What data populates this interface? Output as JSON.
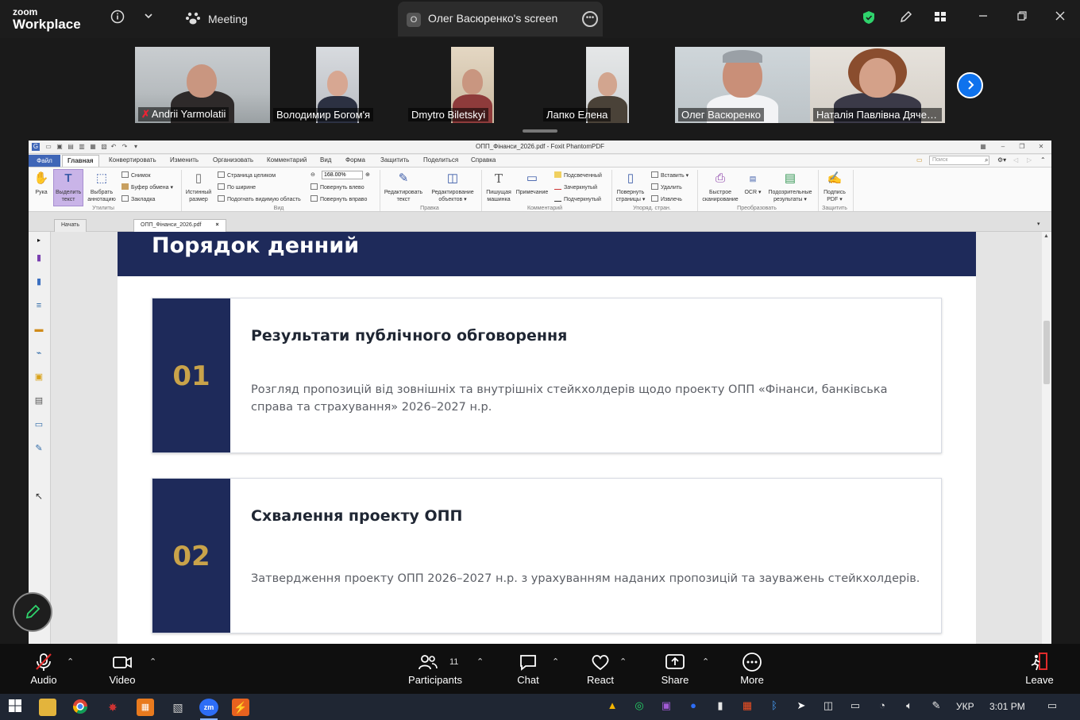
{
  "zoom": {
    "brand_line1": "zoom",
    "brand_line2": "Workplace",
    "meeting_tab": "Meeting",
    "screen_tab_badge": "O",
    "screen_tab": "Олег Васюренко's screen",
    "icons": [
      "info-icon",
      "chevron-down-icon",
      "meeting-paw-icon",
      "more-icon",
      "shield-icon",
      "pencil-icon",
      "grid-icon",
      "minimize-icon",
      "restore-icon",
      "close-icon"
    ]
  },
  "participants": [
    {
      "name": "Andrii Yarmolatii",
      "muted": true,
      "active": false
    },
    {
      "name": "Володимир Богом'я",
      "muted": false,
      "active": false
    },
    {
      "name": "Dmytro Biletskyi",
      "muted": false,
      "active": false
    },
    {
      "name": "Лапко Елена",
      "muted": false,
      "active": false
    },
    {
      "name": "Олег Васюренко",
      "muted": false,
      "active": true
    },
    {
      "name": "Наталія Павлівна Дячен...",
      "muted": false,
      "active": false
    }
  ],
  "app": {
    "title": "ОПП_Фінанси_2026.pdf - Foxit PhantomPDF",
    "menu_tabs": {
      "file": "Файл",
      "home": "Главная",
      "convert": "Конвертировать",
      "edit": "Изменить",
      "organize": "Организовать",
      "comment": "Комментарий",
      "view": "Вид",
      "form": "Форма",
      "protect": "Защитить",
      "share": "Поделиться",
      "help": "Справка"
    },
    "search_placeholder": "Поиск",
    "ribbon": {
      "hand": "Рука",
      "select_text": "Выделить текст",
      "select_annotation": "Выбрать аннотацию",
      "snapshot": "Снимок",
      "clipboard": "Буфер обмена ▾",
      "bookmark": "Закладка",
      "group_utilities": "Утилиты",
      "actual_size": "Истинный размер",
      "fit_page": "Страница целиком",
      "fit_width": "По ширине",
      "fit_visible": "Подогнать видимую область",
      "zoom_value": "168.00%",
      "rotate_left": "Повернуть влево",
      "rotate_right": "Повернуть вправо",
      "group_view": "Вид",
      "edit_text": "Редактировать текст",
      "edit_objects": "Редактирование объектов ▾",
      "group_edit": "Правка",
      "typewriter": "Пишущая машинка",
      "note": "Примечание",
      "highlight": "Подсвеченный",
      "strikeout": "Зачеркнутый",
      "underline": "Подчеркнутый",
      "group_comment": "Комментарий",
      "rotate_pages": "Повернуть страницы ▾",
      "insert": "Вставить ▾",
      "delete": "Удалить",
      "extract": "Извлечь",
      "group_pages": "Упоряд. стран.",
      "quick_scan": "Быстрое сканирование",
      "ocr": "OCR ▾",
      "suspect_results": "Подозрительные результаты ▾",
      "group_convert": "Преобразовать",
      "sign_pdf": "Подпись PDF ▾",
      "group_protect": "Защитить"
    },
    "doc_tabs": {
      "start": "Начать",
      "file": "ОПП_Фінанси_2026.pdf"
    }
  },
  "slide": {
    "title": "Порядок денний",
    "items": [
      {
        "number": "01",
        "title": "Результати публічного обговорення",
        "desc": "Розгляд пропозицій від зовнішніх та внутрішніх стейкхолдерів щодо проекту ОПП «Фінанси, банківська справа та страхування» 2026–2027 н.р."
      },
      {
        "number": "02",
        "title": "Схвалення проекту ОПП",
        "desc": "Затвердження проекту ОПП 2026–2027 н.р. з урахуванням наданих пропозицій та зауважень стейкхолдерів."
      }
    ]
  },
  "controls": {
    "audio": "Audio",
    "video": "Video",
    "participants": "Participants",
    "participants_count": "11",
    "chat": "Chat",
    "react": "React",
    "share": "Share",
    "more": "More",
    "leave": "Leave"
  },
  "taskbar": {
    "language": "УКР",
    "time": "3:01 PM"
  },
  "colors": {
    "slide_navy": "#1e2a5a",
    "slide_gold": "#c9a34a",
    "zoom_blue": "#0e72ed",
    "active_green": "#2fd36c"
  }
}
